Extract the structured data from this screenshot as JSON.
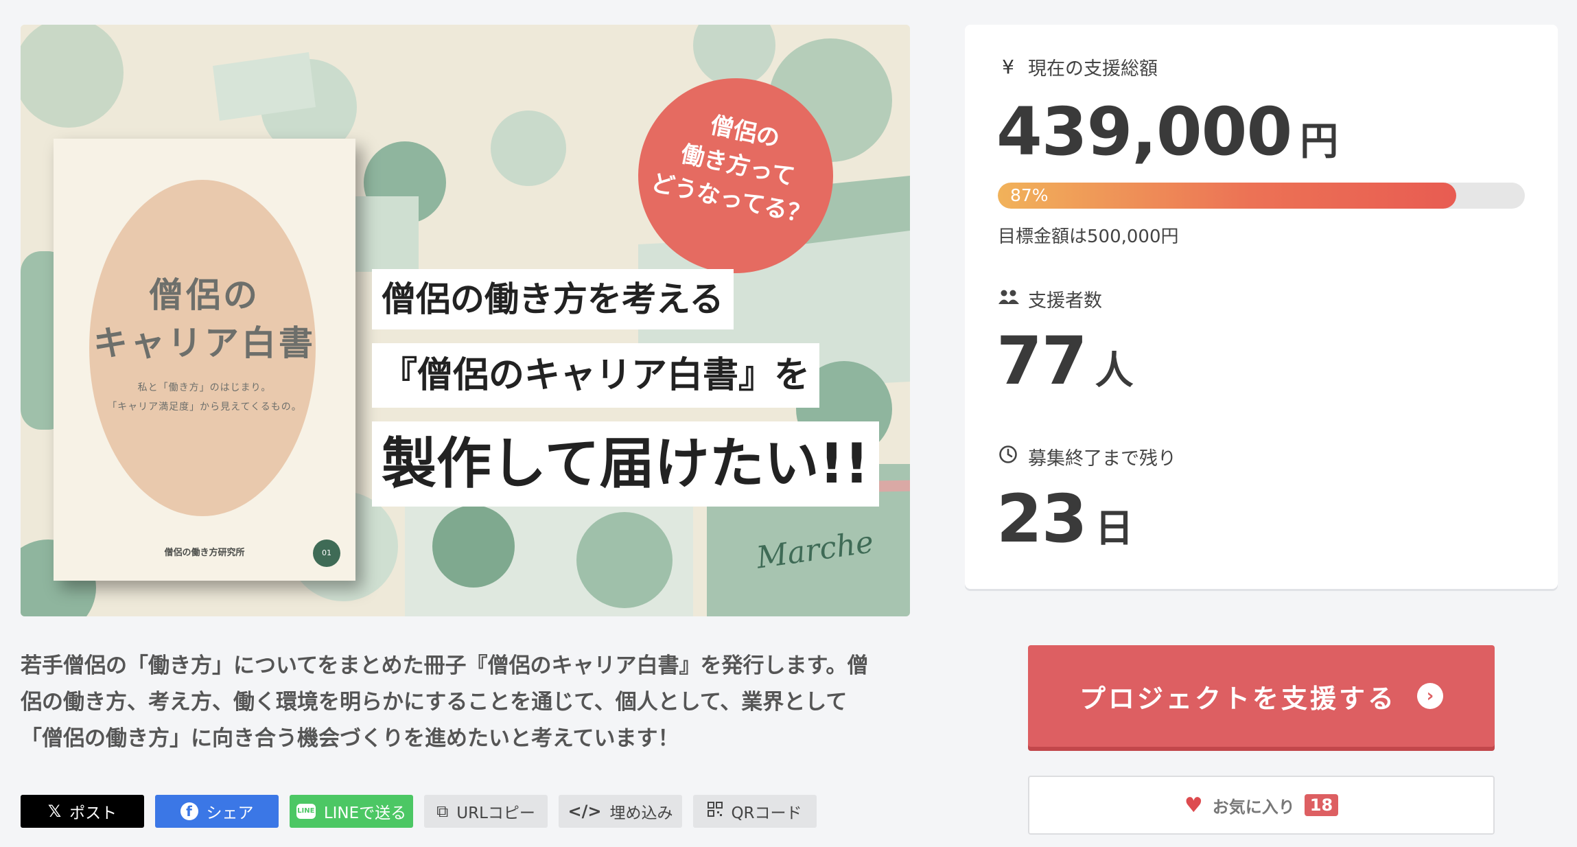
{
  "hero": {
    "badge_lines": [
      "僧侶の",
      "働き方って",
      "どうなってる？"
    ],
    "banner_line1": "僧侶の働き方を考える",
    "banner_line2": "『僧侶のキャリア白書』を",
    "banner_line3": "製作して届けたい!!",
    "marche_text": "Marche",
    "book": {
      "title_line1": "僧侶の",
      "title_line2": "キャリア白書",
      "subtitle_line1": "私と「働き方」のはじまり。",
      "subtitle_line2": "「キャリア満足度」から見えてくるもの。",
      "footer": "僧侶の働き方研究所",
      "badge": "01"
    }
  },
  "stats": {
    "amount": {
      "icon": "yen-icon",
      "label": "現在の支援総額",
      "value": "439,000",
      "unit": "円"
    },
    "progress": {
      "percent_text": "87%",
      "fraction": 0.87
    },
    "goal": "目標金額は500,000円",
    "supporters": {
      "icon": "users-icon",
      "label": "支援者数",
      "value": "77",
      "unit": "人"
    },
    "remaining": {
      "icon": "clock-icon",
      "label": "募集終了まで残り",
      "value": "23",
      "unit": "日"
    }
  },
  "description": {
    "line1": "若手僧侶の「働き方」についてをまとめた冊子『僧侶のキャリア白書』を発行します。僧",
    "line2": "侶の働き方、考え方、働く環境を明らかにすることを通じて、個人として、業界として",
    "line3": "「僧侶の働き方」に向き合う機会づくりを進めたいと考えています！"
  },
  "share": {
    "x": "ポスト",
    "facebook": "シェア",
    "line": "LINEで送る",
    "url": "URLコピー",
    "embed": "埋め込み",
    "qr": "QRコード"
  },
  "cta": {
    "label": "プロジェクトを支援する"
  },
  "favorite": {
    "label": "お気に入り",
    "count": "18"
  },
  "colors": {
    "accent": "#dd5f62",
    "facebook": "#3b77e6",
    "line": "#4cc764",
    "progress_start": "#f1b25a",
    "progress_end": "#e85c52"
  }
}
